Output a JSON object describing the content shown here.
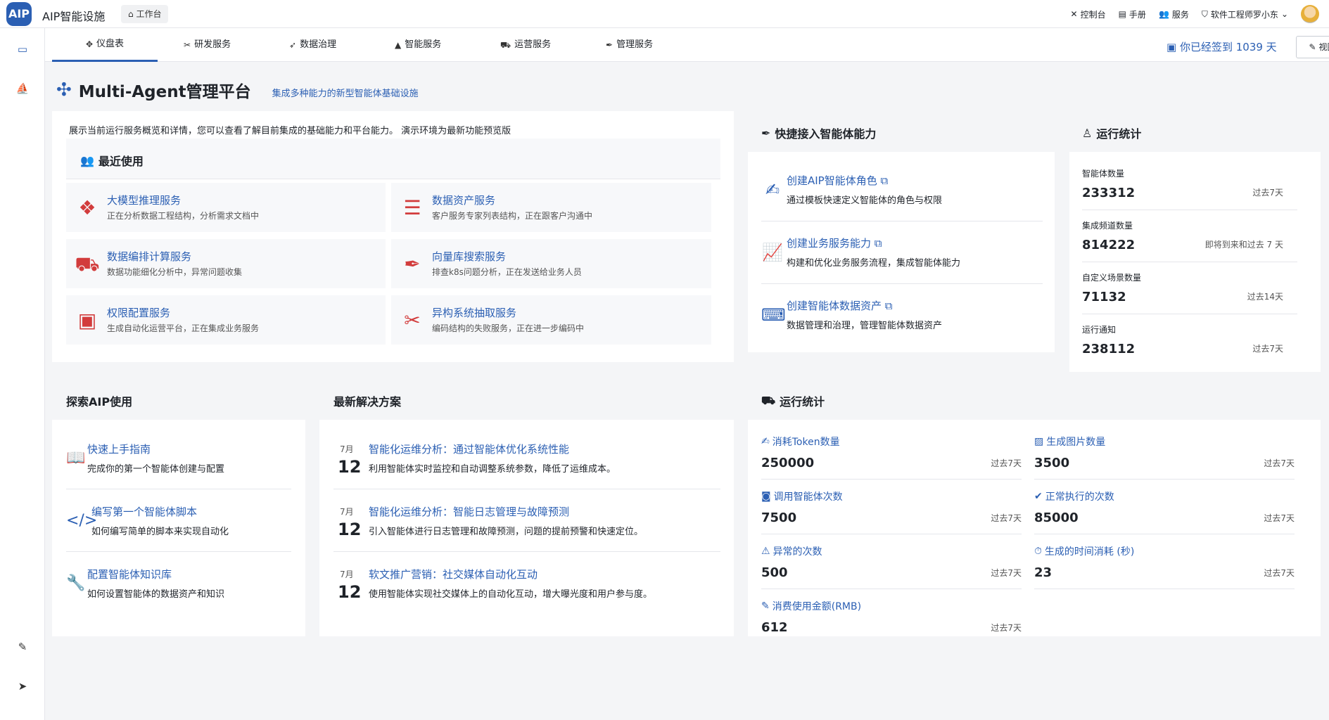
{
  "topbar": {
    "logo": "AIP",
    "app_title": "AIP智能设施",
    "workbench": "工作台",
    "links": [
      {
        "icon": "tools-icon",
        "label": "控制台"
      },
      {
        "icon": "manual-icon",
        "label": "手册"
      },
      {
        "icon": "users-icon",
        "label": "服务"
      }
    ],
    "user": "软件工程师罗小东"
  },
  "tabs": [
    {
      "label": "仪盘表",
      "icon": "dashboard-icon",
      "active": true
    },
    {
      "label": "研发服务",
      "icon": "tools-icon"
    },
    {
      "label": "数据治理",
      "icon": "rocket-icon"
    },
    {
      "label": "智能服务",
      "icon": "ship-icon"
    },
    {
      "label": "运营服务",
      "icon": "truck-icon"
    },
    {
      "label": "管理服务",
      "icon": "feather-icon"
    }
  ],
  "signin_text": "你已经签到 1039 天",
  "view_config": "视图配置",
  "platform": {
    "title": "Multi-Agent管理平台",
    "subtitle": "集成多种能力的新型智能体基础设施"
  },
  "overview_desc": "展示当前运行服务概览和详情，您可以查看了解目前集成的基础能力和平台能力。 演示环境为最新功能预览版",
  "recent": {
    "title": "最近使用",
    "items": [
      {
        "title": "大模型推理服务",
        "sub": "正在分析数据工程结构，分析需求文档中",
        "icon": "file-shield-icon"
      },
      {
        "title": "数据资产服务",
        "sub": "客户服务专家列表结构，正在跟客户沟通中",
        "icon": "server-icon"
      },
      {
        "title": "数据编排计算服务",
        "sub": "数据功能细化分析中，异常问题收集",
        "icon": "truck-icon"
      },
      {
        "title": "向量库搜索服务",
        "sub": "排查k8s问题分析，正在发送给业务人员",
        "icon": "feather-icon"
      },
      {
        "title": "权限配置服务",
        "sub": "生成自动化运营平台，正在集成业务服务",
        "icon": "train-icon"
      },
      {
        "title": "异构系统抽取服务",
        "sub": "编码结构的失败服务，正在进一步编码中",
        "icon": "pencil-ruler-icon"
      }
    ]
  },
  "quick_access": {
    "title": "快捷接入智能体能力",
    "items": [
      {
        "title": "创建AIP智能体角色",
        "sub": "通过模板快速定义智能体的角色与权限",
        "icon": "signature-icon"
      },
      {
        "title": "创建业务服务能力",
        "sub": "构建和优化业务服务流程，集成智能体能力",
        "icon": "chart-file-icon"
      },
      {
        "title": "创建智能体数据资产",
        "sub": "数据管理和治理，管理智能体数据资产",
        "icon": "laptop-code-icon"
      }
    ]
  },
  "run_stats": {
    "title": "运行统计",
    "rows": [
      {
        "label": "智能体数量",
        "value": "233312",
        "period": "过去7天"
      },
      {
        "label": "集成频道数量",
        "value": "814222",
        "period": "即将到来和过去 7 天"
      },
      {
        "label": "自定义场景数量",
        "value": "71132",
        "period": "过去14天"
      },
      {
        "label": "运行通知",
        "value": "238112",
        "period": "过去7天"
      }
    ]
  },
  "explore": {
    "title": "探索AIP使用",
    "items": [
      {
        "title": "快速上手指南",
        "sub": "完成你的第一个智能体创建与配置",
        "icon": "book-reader-icon"
      },
      {
        "title": "编写第一个智能体脚本",
        "sub": "如何编写简单的脚本来实现自动化",
        "icon": "code-icon"
      },
      {
        "title": "配置智能体知识库",
        "sub": "如何设置智能体的数据资产和知识",
        "icon": "wrench-icon"
      }
    ]
  },
  "solutions": {
    "title": "最新解决方案",
    "items": [
      {
        "month": "7月",
        "day": "12",
        "title": "智能化运维分析：通过智能体优化系统性能",
        "sub": "利用智能体实时监控和自动调整系统参数，降低了运维成本。"
      },
      {
        "month": "7月",
        "day": "12",
        "title": "智能化运维分析：智能日志管理与故障预测",
        "sub": "引入智能体进行日志管理和故障预测，问题的提前预警和快速定位。"
      },
      {
        "month": "7月",
        "day": "12",
        "title": "软文推广营销：社交媒体自动化互动",
        "sub": "使用智能体实现社交媒体上的自动化互动，增大曝光度和用户参与度。"
      }
    ]
  },
  "op_stats": {
    "title": "运行统计",
    "items": [
      {
        "label": "消耗Token数量",
        "value": "250000",
        "period": "过去7天",
        "icon": "signature-icon"
      },
      {
        "label": "生成图片数量",
        "value": "3500",
        "period": "过去7天",
        "icon": "image-icon"
      },
      {
        "label": "调用智能体次数",
        "value": "7500",
        "period": "过去7天",
        "icon": "robot-icon"
      },
      {
        "label": "正常执行的次数",
        "value": "85000",
        "period": "过去7天",
        "icon": "check-circle-icon"
      },
      {
        "label": "异常的次数",
        "value": "500",
        "period": "过去7天",
        "icon": "warning-icon"
      },
      {
        "label": "生成的时间消耗 (秒)",
        "value": "23",
        "period": "过去7天",
        "icon": "stopwatch-icon"
      },
      {
        "label": "消费使用金额(RMB)",
        "value": "612",
        "period": "过去7天",
        "icon": "file-signature-icon"
      }
    ]
  },
  "colors": {
    "accent": "#2b5fb3",
    "danger": "#d23c3c",
    "text": "#1f2329",
    "background": "#f4f5f7"
  }
}
